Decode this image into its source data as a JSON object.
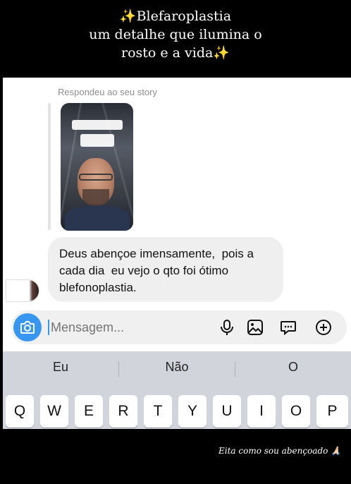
{
  "caption": {
    "line1": "✨Blefaroplastia",
    "line2": "um detalhe que ilumina o",
    "line3": "rosto e a vida✨"
  },
  "chat": {
    "replied_label": "Respondeu ao seu story",
    "message_lines": [
      "Deus abençoe imensamente,  pois a",
      "cada dia  eu vejo o qto foi ótimo",
      "blefonoplastia."
    ]
  },
  "composer": {
    "placeholder": "Mensagem...",
    "icons": [
      "camera-icon",
      "microphone-icon",
      "gallery-icon",
      "sticker-icon",
      "add-icon"
    ],
    "accent": "#3797f0"
  },
  "keyboard": {
    "suggestions": [
      "Eu",
      "Não",
      "O"
    ],
    "keys": [
      "Q",
      "W",
      "E",
      "R",
      "T",
      "Y",
      "U",
      "I",
      "O",
      "P"
    ]
  },
  "footer": {
    "text": "Eita como sou abençoado 🙏🏻"
  }
}
